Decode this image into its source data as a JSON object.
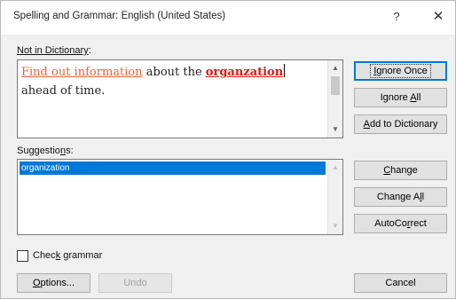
{
  "window": {
    "title": "Spelling and Grammar: English (United States)",
    "help_label": "?",
    "close_label": "✕"
  },
  "not_in_dictionary": {
    "label_before": "Not in Dictionary",
    "label_after": ":",
    "grammar_error_text": "Find out information",
    "plain_text_1": " about the ",
    "spelling_error_text": "organzation",
    "plain_text_2": "ahead of time."
  },
  "suggestions": {
    "label_before": "Suggestio",
    "label_access": "n",
    "label_after": "s:",
    "items": [
      "organization"
    ],
    "selected_index": 0
  },
  "buttons": {
    "ignore_once": {
      "a": "I",
      "b": "gnore Once"
    },
    "ignore_all": {
      "a": "Ignore ",
      "u": "A",
      "b": "ll"
    },
    "add_to_dictionary": {
      "u": "A",
      "b": "dd to Dictionary"
    },
    "change": {
      "u": "C",
      "b": "hange"
    },
    "change_all": {
      "a": "Change A",
      "u": "l",
      "b": "l"
    },
    "autocorrect": {
      "a": "AutoCo",
      "u": "r",
      "b": "rect"
    },
    "options": {
      "u": "O",
      "b": "ptions..."
    },
    "undo": {
      "label": "Undo"
    },
    "cancel": {
      "label": "Cancel"
    }
  },
  "check_grammar": {
    "label_before": "Chec",
    "label_access": "k",
    "label_after": " grammar",
    "checked": false
  },
  "colors": {
    "spelling_error": "#d81818",
    "grammar_error": "#e4643f",
    "selection": "#0078d7",
    "default_button_border": "#0078d7"
  },
  "icons": {
    "scroll_up": "▲",
    "scroll_down": "▼"
  }
}
